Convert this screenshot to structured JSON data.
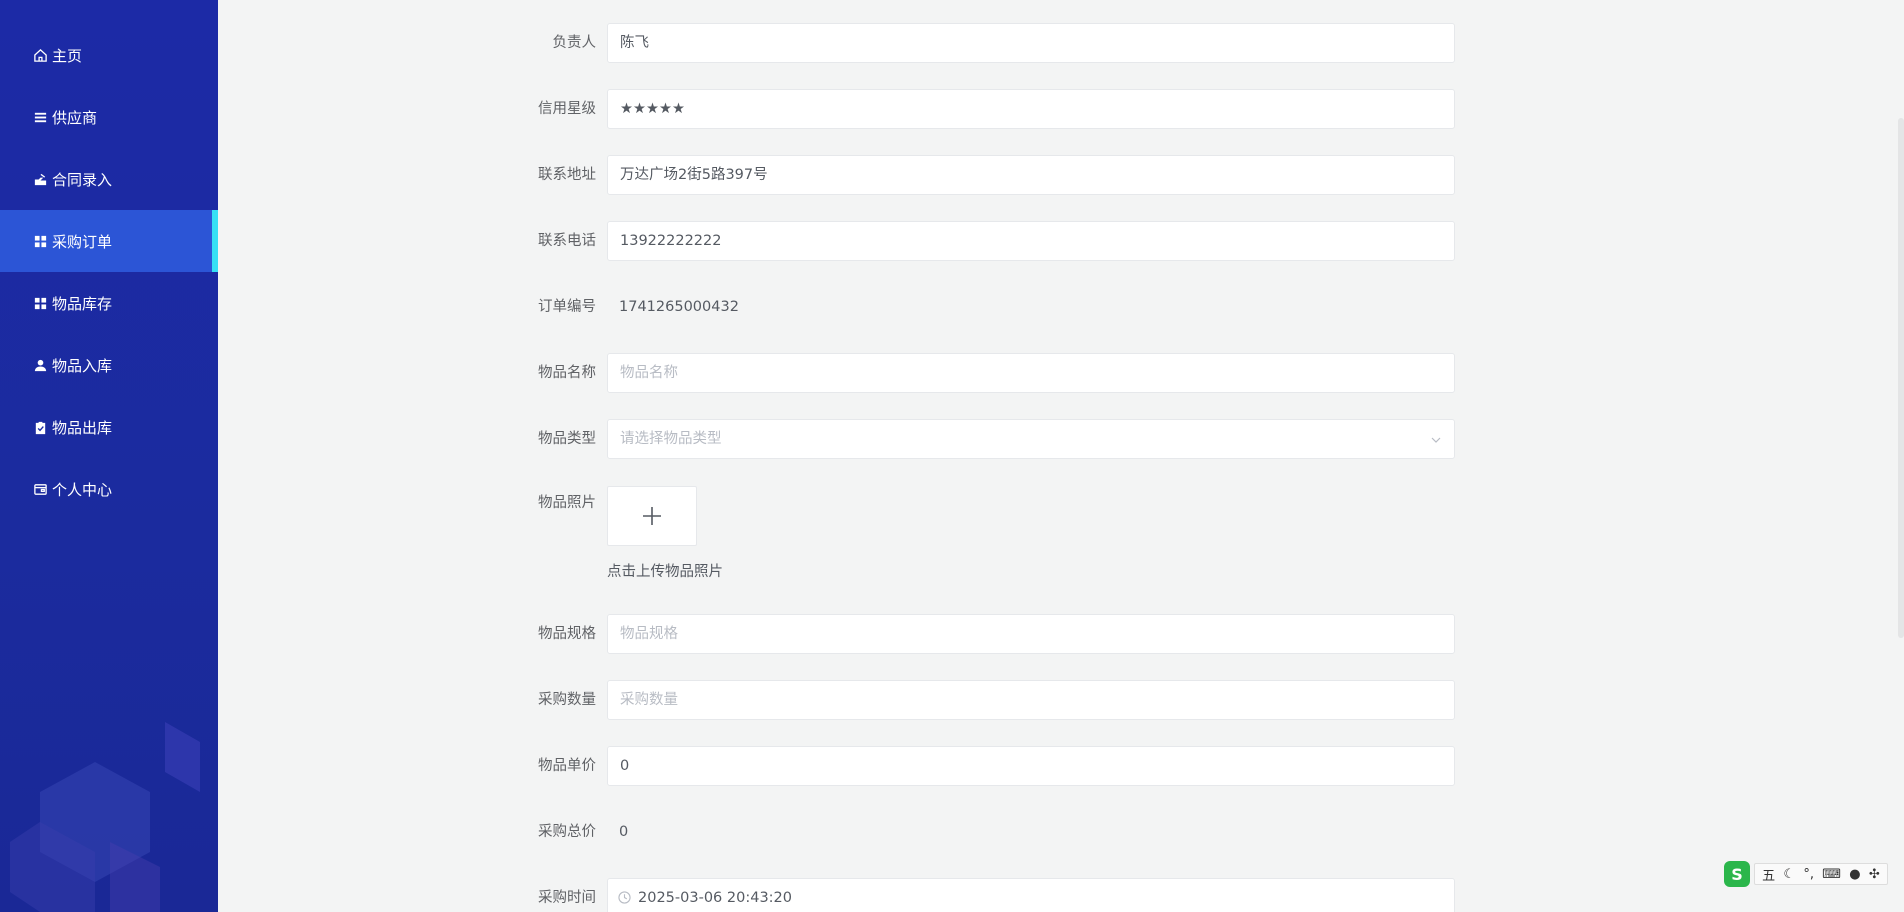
{
  "sidebar": {
    "items": [
      {
        "label": "主页",
        "icon": "home-icon"
      },
      {
        "label": "供应商",
        "icon": "list-icon"
      },
      {
        "label": "合同录入",
        "icon": "contract-icon"
      },
      {
        "label": "采购订单",
        "icon": "grid-icon",
        "active": true
      },
      {
        "label": "物品库存",
        "icon": "grid-icon"
      },
      {
        "label": "物品入库",
        "icon": "user-icon"
      },
      {
        "label": "物品出库",
        "icon": "clipboard-icon"
      },
      {
        "label": "个人中心",
        "icon": "wallet-icon"
      }
    ]
  },
  "form": {
    "owner": {
      "label": "负责人",
      "value": "陈飞"
    },
    "credit": {
      "label": "信用星级",
      "value": "★★★★★"
    },
    "address": {
      "label": "联系地址",
      "value": "万达广场2街5路397号"
    },
    "phone": {
      "label": "联系电话",
      "value": "13922222222"
    },
    "order_no": {
      "label": "订单编号",
      "value": "1741265000432"
    },
    "item_name": {
      "label": "物品名称",
      "placeholder": "物品名称",
      "value": ""
    },
    "item_type": {
      "label": "物品类型",
      "placeholder": "请选择物品类型"
    },
    "item_photo": {
      "label": "物品照片",
      "hint": "点击上传物品照片"
    },
    "spec": {
      "label": "物品规格",
      "placeholder": "物品规格"
    },
    "quantity": {
      "label": "采购数量",
      "placeholder": "采购数量"
    },
    "unit_price": {
      "label": "物品单价",
      "value": "0"
    },
    "total": {
      "label": "采购总价",
      "value": "0"
    },
    "time": {
      "label": "采购时间",
      "value": "2025-03-06 20:43:20"
    }
  },
  "ime": {
    "mode": "五",
    "logo": "S"
  },
  "colors": {
    "sidebar": "#1c2aa6",
    "active": "#2c55d6",
    "accent": "#35e0f5"
  }
}
